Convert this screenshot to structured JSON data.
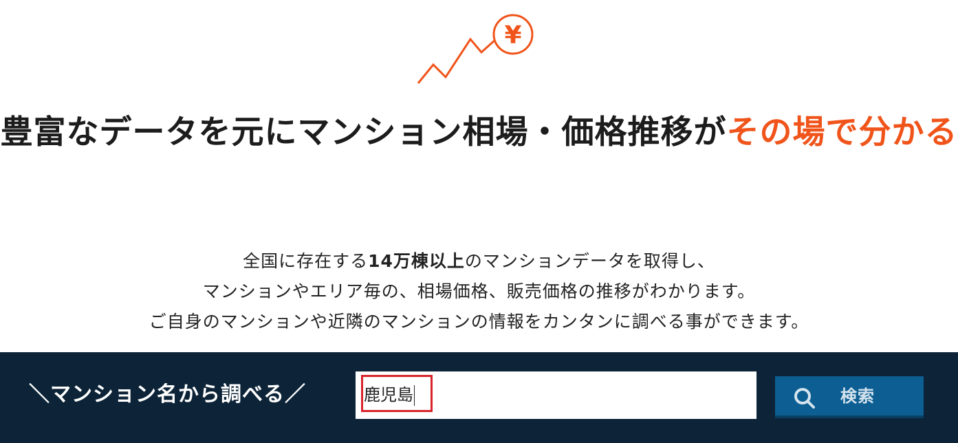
{
  "hero": {
    "logo_symbol": "¥",
    "headline_main": "豊富なデータを元にマンション相場・価格推移が",
    "headline_accent": "その場で分かる",
    "description": {
      "line1_pre": "全国に存在する",
      "line1_bold": "14万棟以上",
      "line1_post": "のマンションデータを取得し、",
      "line2": "マンションやエリア毎の、相場価格、販売価格の推移がわかります。",
      "line3": "ご自身のマンションや近隣のマンションの情報をカンタンに調べる事ができます。"
    }
  },
  "search": {
    "heading": "＼マンション名から調べる／",
    "input_value": "鹿児島",
    "button_label": "検索",
    "button_icon": "search-icon"
  },
  "colors": {
    "accent": "#f0541a",
    "band_bg": "#0d2438",
    "button_bg": "#0c5e93",
    "highlight": "#d8232a"
  }
}
